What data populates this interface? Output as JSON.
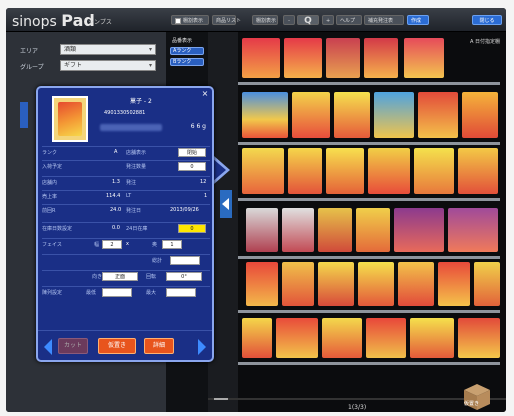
{
  "app": {
    "title_prefix": "sinops",
    "title_main": "Pad",
    "subtitle": "シンプス"
  },
  "toolbar": {
    "checkbox_label": "棚割表示",
    "btn1": "商品リスト",
    "btn2": "棚割表示",
    "zoom_out": "-",
    "search": "Q",
    "zoom_in": "+",
    "btn3": "ヘルプ",
    "btn4": "補充発注表",
    "btn5": "作成",
    "close": "閉じる"
  },
  "left_panel": {
    "row1_label": "エリア",
    "row1_value": "酒類",
    "row2_label": "グループ",
    "row2_value": "ギフト"
  },
  "results": {
    "label": "品番表示",
    "btn1": "Aランク",
    "btn2": "Bランク"
  },
  "shelf": {
    "tag": "A 日付指定棚",
    "page": "1(3/3)",
    "box_label": "仮置き"
  },
  "popup": {
    "close": "×",
    "product_name": "菓子 - 2",
    "jan": "4901330502881",
    "size": "6 6 g",
    "rows": {
      "rank_label": "ランク",
      "rank_value": "A",
      "display_label": "店舗表示",
      "display_value": "閉始",
      "plan_label": "入荷予定",
      "plan_label2": "発注数量",
      "plan_value": "0",
      "sales_label": "店舗内",
      "sales_value": "1.3",
      "sales_label2": "発注",
      "sales_value2": "12",
      "avg_label": "売上率",
      "avg_value": "114.4",
      "avg_label2": "LT",
      "avg_value2": "1",
      "date_label": "前回R",
      "date_value": "24.0",
      "date_label2": "発注日",
      "date_value2": "2013/09/26",
      "stock_label": "在庫日数設定",
      "stock_value": "0.0",
      "stock_label2": "24日在庫",
      "stock_value2": "0",
      "face_label": "フェイス",
      "face_label2": "幅",
      "face_value": "2",
      "face_x": "x",
      "face_label3": "奥",
      "face_value2": "1",
      "total_label": "総計",
      "pos_label": "向き",
      "pos_value": "正面",
      "rot_label": "回転",
      "rot_value": "0°",
      "min_label": "陳列設定",
      "min_label2": "最低",
      "min_label3": "最大"
    },
    "footer": {
      "cut": "カット",
      "put": "仮置き",
      "detail": "詳細"
    }
  },
  "colors": {
    "popup_bg": "#1a2f86",
    "accent_blue": "#2a5fbf",
    "orange": "#e8541d",
    "yellow": "#ffe600"
  }
}
